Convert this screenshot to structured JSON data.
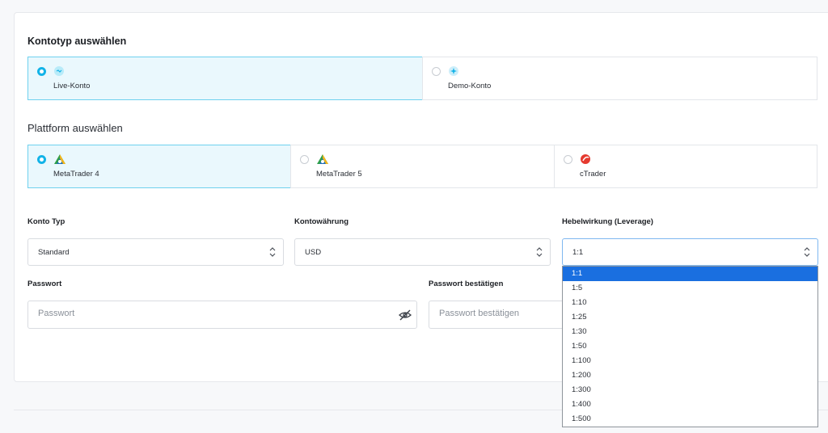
{
  "account_type": {
    "title": "Kontotyp auswählen",
    "options": [
      {
        "label": "Live-Konto",
        "selected": true,
        "icon": "live-account-icon"
      },
      {
        "label": "Demo-Konto",
        "selected": false,
        "icon": "demo-account-icon"
      }
    ]
  },
  "platform": {
    "title": "Plattform auswählen",
    "options": [
      {
        "label": "MetaTrader 4",
        "selected": true,
        "icon": "metatrader-4-logo"
      },
      {
        "label": "MetaTrader 5",
        "selected": false,
        "icon": "metatrader-5-logo"
      },
      {
        "label": "cTrader",
        "selected": false,
        "icon": "ctrader-logo"
      }
    ]
  },
  "fields": {
    "account_kind": {
      "label": "Konto Typ",
      "value": "Standard"
    },
    "currency": {
      "label": "Kontowährung",
      "value": "USD"
    },
    "leverage": {
      "label": "Hebelwirkung (Leverage)",
      "value": "1:1"
    },
    "password": {
      "label": "Passwort",
      "placeholder": "Passwort"
    },
    "password_confirm": {
      "label": "Passwort bestätigen",
      "placeholder": "Passwort bestätigen"
    }
  },
  "leverage_options": [
    "1:1",
    "1:5",
    "1:10",
    "1:25",
    "1:30",
    "1:50",
    "1:100",
    "1:200",
    "1:300",
    "1:400",
    "1:500"
  ],
  "colors": {
    "accent": "#12b3e8",
    "selected_bg": "#eaf8fd",
    "dropdown_highlight": "#1a6fe0"
  }
}
